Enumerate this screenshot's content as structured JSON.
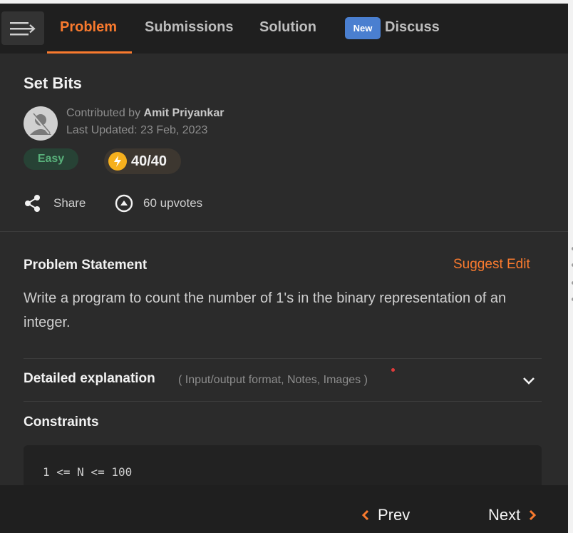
{
  "header": {
    "tabs": [
      {
        "label": "Problem"
      },
      {
        "label": "Submissions"
      },
      {
        "label": "Solution"
      },
      {
        "label": "Discuss",
        "badge": "New"
      }
    ]
  },
  "problem": {
    "title": "Set Bits",
    "contributed_prefix": "Contributed by ",
    "contributor": "Amit Priyankar",
    "last_updated": "Last Updated: 23 Feb, 2023",
    "difficulty": "Easy",
    "score": "40/40",
    "share_label": "Share",
    "upvotes": "60 upvotes"
  },
  "statement": {
    "title": "Problem Statement",
    "suggest_edit": "Suggest Edit",
    "text": "Write a program to count the number of 1's in the binary representation of an integer.",
    "detail_title": "Detailed explanation",
    "detail_sub": "( Input/output format, Notes, Images )",
    "constraints_title": "Constraints",
    "constraint_code": "1 <= N <= 100"
  },
  "footer": {
    "prev": "Prev",
    "next": "Next"
  },
  "colors": {
    "accent": "#f97a2e",
    "easy": "#58b07a",
    "badge": "#4a7fd0",
    "bolt": "#f6b01d"
  },
  "icons": [
    "menu-icon",
    "avatar-icon",
    "lightning-icon",
    "share-icon",
    "upvote-icon",
    "chevron-down-icon",
    "chevron-left-icon",
    "chevron-right-icon"
  ]
}
